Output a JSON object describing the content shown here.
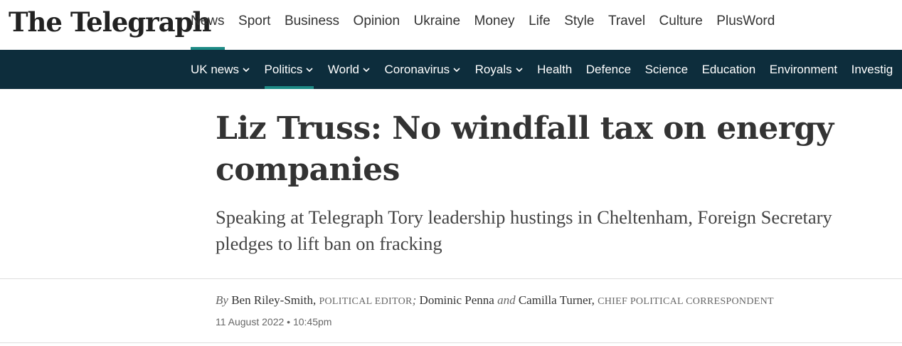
{
  "brand": {
    "logo_text": "The Telegraph"
  },
  "main_nav": {
    "items": [
      "News",
      "Sport",
      "Business",
      "Opinion",
      "Ukraine",
      "Money",
      "Life",
      "Style",
      "Travel",
      "Culture",
      "PlusWord"
    ],
    "active": "News"
  },
  "sub_nav": {
    "items": [
      {
        "label": "UK news",
        "has_dropdown": true
      },
      {
        "label": "Politics",
        "has_dropdown": true
      },
      {
        "label": "World",
        "has_dropdown": true
      },
      {
        "label": "Coronavirus",
        "has_dropdown": true
      },
      {
        "label": "Royals",
        "has_dropdown": true
      },
      {
        "label": "Health",
        "has_dropdown": false
      },
      {
        "label": "Defence",
        "has_dropdown": false
      },
      {
        "label": "Science",
        "has_dropdown": false
      },
      {
        "label": "Education",
        "has_dropdown": false
      },
      {
        "label": "Environment",
        "has_dropdown": false
      },
      {
        "label": "Investig",
        "has_dropdown": false
      }
    ],
    "active": "Politics"
  },
  "article": {
    "headline": "Liz Truss: No windfall tax on energy companies",
    "standfirst": "Speaking at Telegraph Tory leadership hustings in Cheltenham, Foreign Secretary pledges to lift ban on fracking",
    "byline": {
      "by": "By",
      "author1": "Ben Riley-Smith",
      "role1": "Political Editor",
      "separator": ";",
      "author2": "Dominic Penna",
      "conjunction": "and",
      "author3": "Camilla Turner",
      "role3": "Chief Political Correspondent"
    },
    "date": "11 August 2022 • 10:45pm"
  },
  "colors": {
    "accent": "#1d8a85",
    "subnav_bg": "#0d2d3c",
    "text": "#333333"
  }
}
